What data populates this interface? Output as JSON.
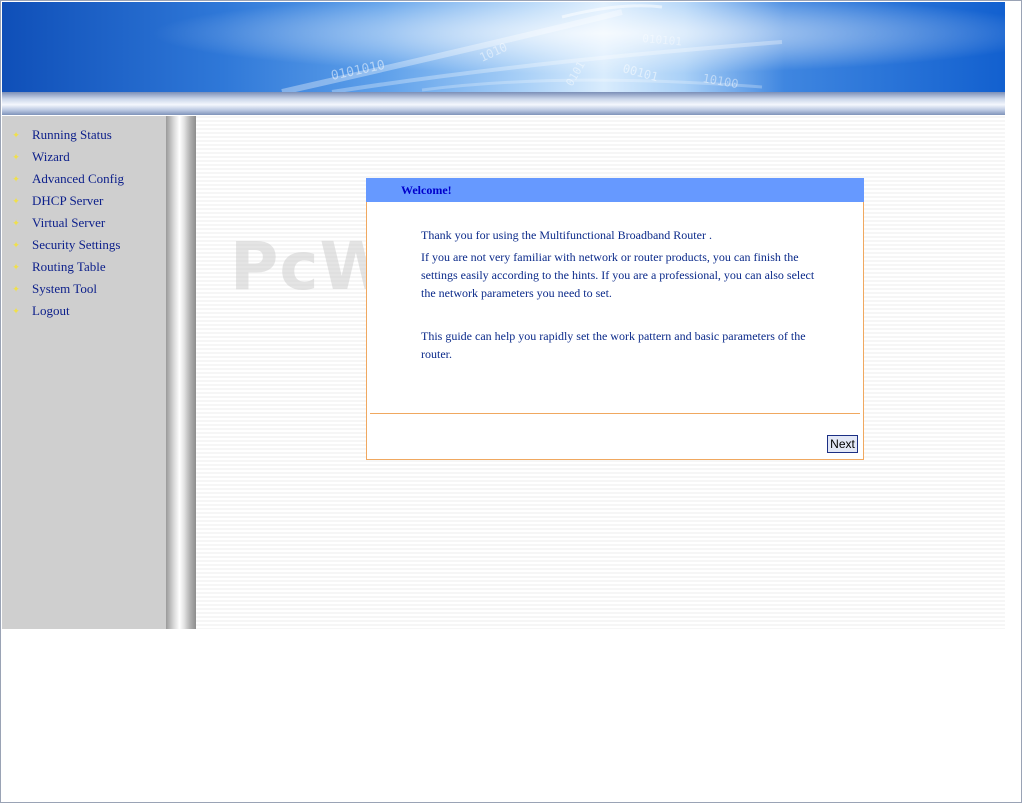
{
  "header": {
    "banner_digits": [
      "0101010",
      "1010",
      "00101",
      "10100",
      "0101",
      "010101"
    ]
  },
  "sidebar": {
    "items": [
      {
        "label": "Running Status"
      },
      {
        "label": "Wizard"
      },
      {
        "label": "Advanced Config"
      },
      {
        "label": "DHCP Server"
      },
      {
        "label": "Virtual Server"
      },
      {
        "label": "Security Settings"
      },
      {
        "label": "Routing Table"
      },
      {
        "label": "System Tool"
      },
      {
        "label": "Logout"
      }
    ],
    "bullet_glyph": "✦"
  },
  "watermark": "PcWinTech.com",
  "welcome": {
    "title": "Welcome!",
    "para1": "Thank you for using the Multifunctional Broadband Router .",
    "para2": "If you are not very familiar with network or router products, you can finish the settings easily according to the hints. If you are a professional, you can also select the network parameters you need to set.",
    "para3": "This guide can help you rapidly set the work pattern and basic parameters of the router.",
    "next_label": "Next"
  },
  "colors": {
    "title_bar": "#6699ff",
    "title_text": "#0000cc",
    "menu_text": "#0b1e8a",
    "panel_border": "#f0a860",
    "sidebar_bg": "#cfcfcf"
  }
}
